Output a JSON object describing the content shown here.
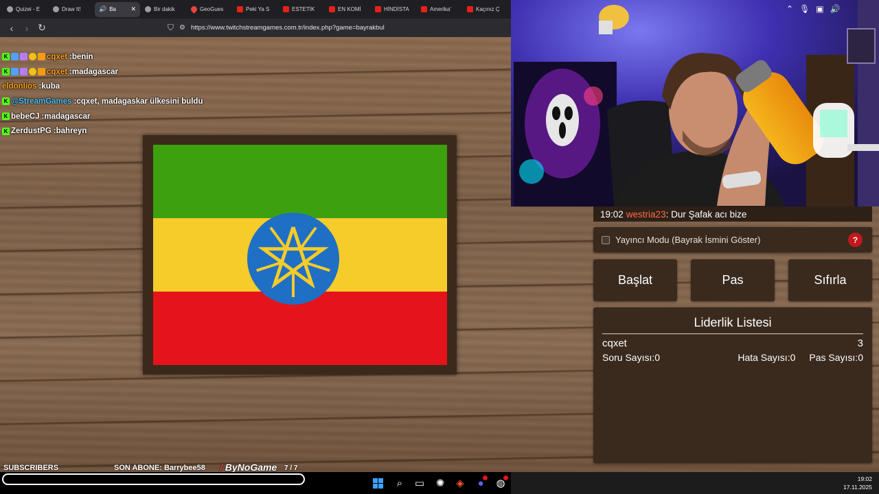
{
  "browser": {
    "tabs": [
      {
        "label": "Quizei - E",
        "favicon": "globe-icon",
        "active": false
      },
      {
        "label": "Draw It!",
        "favicon": "globe-icon",
        "active": false
      },
      {
        "label": "Ba",
        "favicon": "speaker-icon",
        "active": true
      },
      {
        "label": "Bir dakik",
        "favicon": "globe-icon",
        "active": false
      },
      {
        "label": "GeoGues",
        "favicon": "map-pin-icon",
        "active": false
      },
      {
        "label": "Peki Ya S",
        "favicon": "youtube-icon",
        "active": false
      },
      {
        "label": "ESTETİK",
        "favicon": "youtube-icon",
        "active": false
      },
      {
        "label": "EN KOMİ",
        "favicon": "youtube-icon",
        "active": false
      },
      {
        "label": "HİNDİSTA",
        "favicon": "youtube-icon",
        "active": false
      },
      {
        "label": "Amerika'",
        "favicon": "youtube-icon",
        "active": false
      },
      {
        "label": "Kaçınız Ç",
        "favicon": "youtube-icon",
        "active": false
      }
    ],
    "url": "https://www.twitchstreamgames.com.tr/index.php?game=bayrakbul"
  },
  "chat": [
    {
      "user": "cqxet",
      "user_color": "#ff9f1a",
      "message": "benin",
      "badges": [
        "k",
        "b2",
        "b3",
        "b4",
        "b5"
      ]
    },
    {
      "user": "cqxet",
      "user_color": "#ff9f1a",
      "message": "madagascar",
      "badges": [
        "k",
        "b2",
        "b3",
        "b4",
        "b5"
      ]
    },
    {
      "user": "eldonlios",
      "user_color": "#ff9f1a",
      "message": "kuba",
      "badges": []
    },
    {
      "user": "@StreamGames",
      "user_color": "#4fc3f7",
      "message": "cqxet, madagaskar ülkesini buldu",
      "badges": [
        "k"
      ]
    },
    {
      "user": "bebeCJ",
      "user_color": "#ffffff",
      "message": "madagascar",
      "badges": [
        "k"
      ]
    },
    {
      "user": "ZerdustPG",
      "user_color": "#ffffff",
      "message": "bahreyn",
      "badges": [
        "k"
      ]
    }
  ],
  "flag": {
    "country_colors": {
      "green": "#3da10f",
      "yellow": "#f6cc2a",
      "red": "#e5131a",
      "blue": "#1f6fc5",
      "star": "#f6cc2a"
    }
  },
  "latest_chat": {
    "time": "19:02",
    "user": "westria23",
    "message": ": Dur Şafak acı bize"
  },
  "streamer_mode": {
    "label": "Yayıncı Modu (Bayrak İsmini Göster)",
    "checked": false,
    "help": "?"
  },
  "buttons": {
    "start": "Başlat",
    "pass": "Pas",
    "reset": "Sıfırla"
  },
  "leaderboard": {
    "title": "Liderlik Listesi",
    "entries": [
      {
        "name": "cqxet",
        "score": "3"
      }
    ],
    "stats": {
      "questions_label": "Soru Sayısı:",
      "questions_value": "0",
      "errors_label": "Hata Sayısı:",
      "errors_value": "0",
      "pass_label": "Pas Sayısı:",
      "pass_value": "0"
    }
  },
  "overlay": {
    "subscribers_label": "SUBSCRIBERS",
    "last_sub_label": "SON ABONE:",
    "last_sub_name": "Barrybee58",
    "brand": "ByNoGame",
    "counter": "7 / 7"
  },
  "taskbar": {
    "time": "19:02",
    "date": "17.11.2025"
  }
}
